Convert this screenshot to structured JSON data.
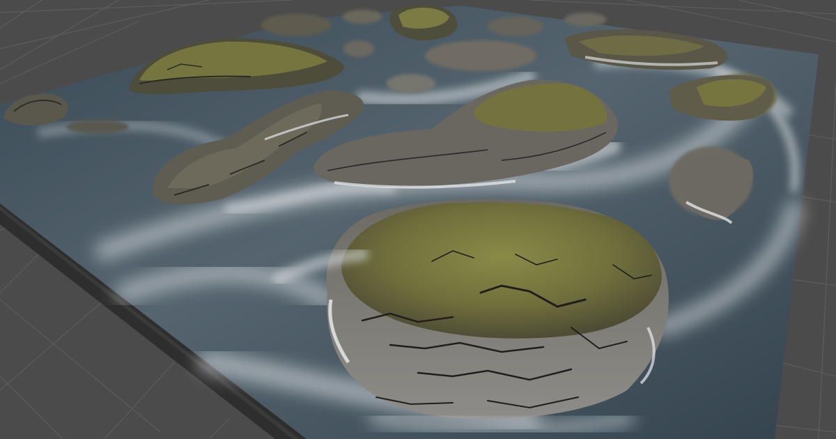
{
  "scene": {
    "view": "unity-scene-view",
    "subject": "terrain-water-rocks",
    "colors": {
      "background": "#4b4b4b",
      "grid_line": "#5c5c5c",
      "slab_side": "#2f2f2f",
      "water_deep": "#2f3f4b",
      "water_mid": "#4a5a66",
      "foam": "#d6dade",
      "rock_moss": "#7a7a3e",
      "rock_grey": "#7b7874",
      "rock_dark": "#2b2a27"
    }
  }
}
